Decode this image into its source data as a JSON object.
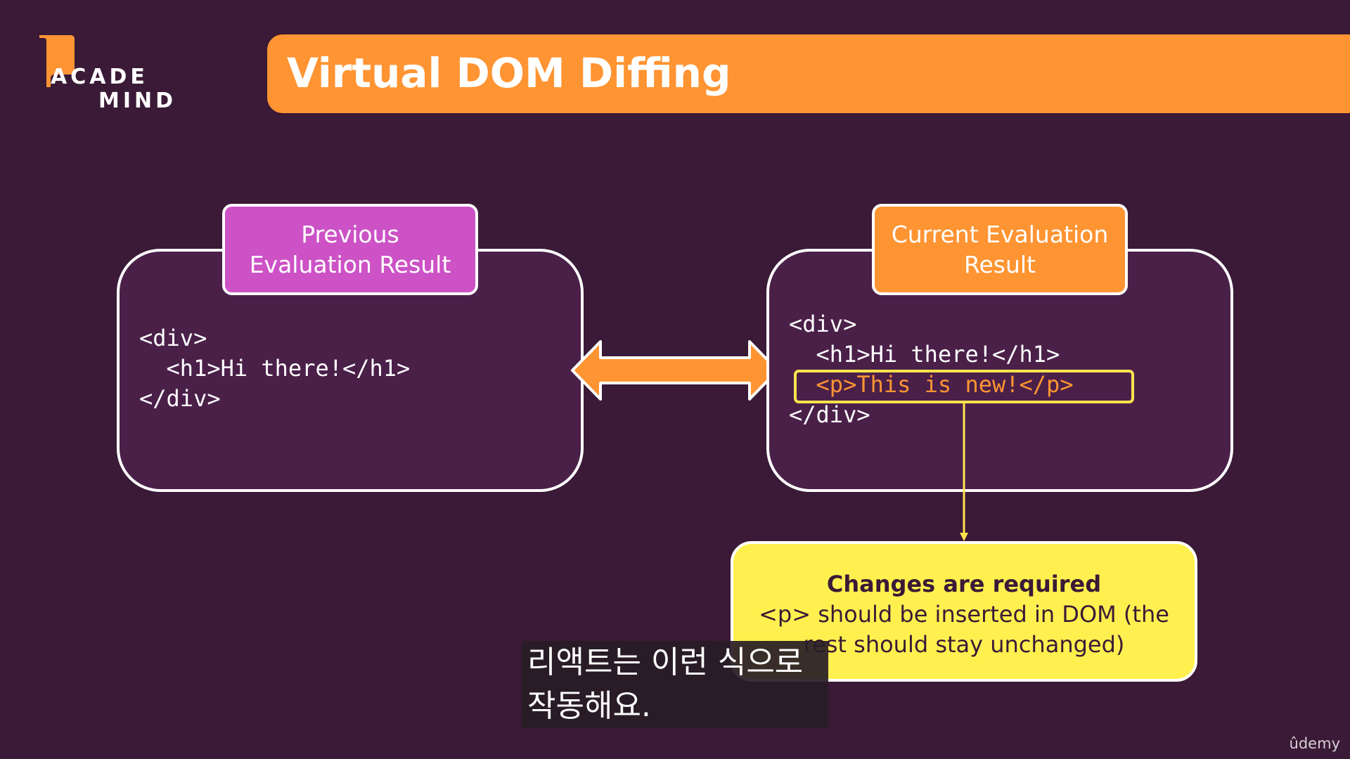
{
  "logo": {
    "line1": "ACADE",
    "line2": "MIND"
  },
  "title": "Virtual DOM Diffing",
  "left_panel": {
    "tab_line1": "Previous",
    "tab_line2": "Evaluation Result",
    "code": [
      "<div>",
      "  <h1>Hi there!</h1>",
      "</div>"
    ]
  },
  "right_panel": {
    "tab_line1": "Current Evaluation",
    "tab_line2": "Result",
    "code": [
      "<div>",
      "  <h1>Hi there!</h1>",
      "  <p>This is new!</p>",
      "</div>"
    ]
  },
  "info": {
    "heading": "Changes are required",
    "line1": "<p> should be inserted in DOM (the",
    "line2": "rest should stay unchanged)"
  },
  "subtitle": {
    "line1": "리액트는 이런 식으로",
    "line2": "작동해요."
  },
  "watermark": "ûdemy",
  "colors": {
    "background": "#3a1a36",
    "orange": "#ff9433",
    "magenta": "#cc52c6",
    "yellow": "#fff04f",
    "highlight": "#ffe34d"
  }
}
